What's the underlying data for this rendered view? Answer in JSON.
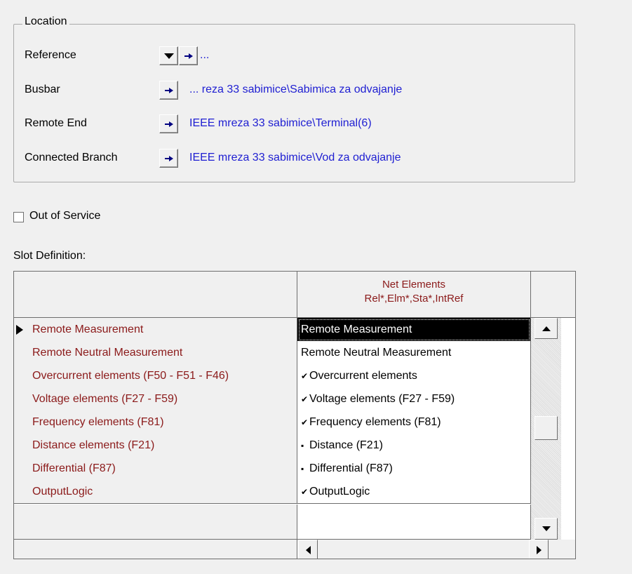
{
  "location": {
    "title": "Location",
    "rows": [
      {
        "label": "Reference",
        "value": "..."
      },
      {
        "label": "Busbar",
        "value": "... reza 33 sabimice\\Sabimica za odvajanje"
      },
      {
        "label": "Remote End",
        "value": "IEEE mreza 33 sabimice\\Terminal(6)"
      },
      {
        "label": "Connected Branch",
        "value": "IEEE mreza 33 sabimice\\Vod za odvajanje"
      }
    ]
  },
  "out_of_service": {
    "label": "Out of Service",
    "checked": false
  },
  "slot_definition": {
    "title": "Slot Definition:",
    "column_header_line1": "Net Elements",
    "column_header_line2": "Rel*,Elm*,Sta*,IntRef",
    "rows": [
      {
        "name": "Remote Measurement",
        "value": "Remote Measurement",
        "mark": ""
      },
      {
        "name": "Remote Neutral Measurement",
        "value": "Remote Neutral Measurement",
        "mark": ""
      },
      {
        "name": "Overcurrent elements (F50 - F51 - F46)",
        "value": "Overcurrent elements",
        "mark": "✔"
      },
      {
        "name": "Voltage elements (F27 - F59)",
        "value": "Voltage elements (F27 - F59)",
        "mark": "✔"
      },
      {
        "name": "Frequency elements (F81)",
        "value": "Frequency elements (F81)",
        "mark": "✔"
      },
      {
        "name": "Distance elements (F21)",
        "value": "Distance (F21)",
        "mark": "▪"
      },
      {
        "name": "Differential (F87)",
        "value": "Differential (F87)",
        "mark": "▪"
      },
      {
        "name": "OutputLogic",
        "value": "OutputLogic",
        "mark": "✔"
      }
    ]
  },
  "colors": {
    "link_blue": "#1e1ed2",
    "row_name_red": "#8b1a1a",
    "background": "#f0f0f0"
  }
}
